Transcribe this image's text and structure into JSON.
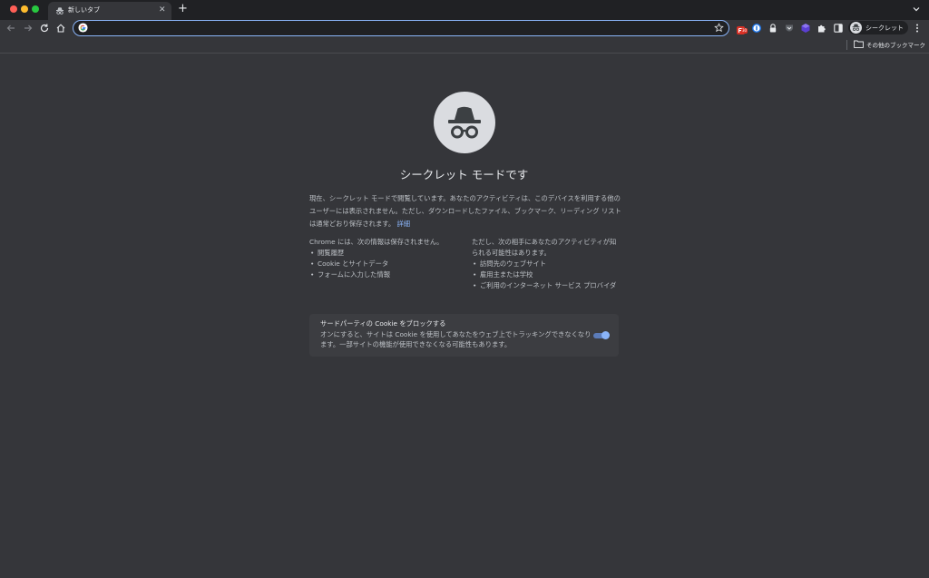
{
  "tab": {
    "title": "新しいタブ",
    "icon": "incognito-icon"
  },
  "omnibox": {
    "value": "",
    "placeholder": ""
  },
  "extensions": {
    "badge_count": "30"
  },
  "profile": {
    "label": "シークレット"
  },
  "bookmarks": {
    "other_label": "その他のブックマーク"
  },
  "incognito": {
    "heading": "シークレット モードです",
    "intro": "現在、シークレット モードで閲覧しています。あなたのアクティビティは、このデバイスを利用する他のユーザーには表示されません。ただし、ダウンロードしたファイル、ブックマーク、リーディング リストは通常どおり保存されます。",
    "learn_more": "詳細",
    "not_saved_title": "Chrome には、次の情報は保存されません。",
    "not_saved_items": [
      "閲覧履歴",
      "Cookie とサイトデータ",
      "フォームに入力した情報"
    ],
    "visible_title": "ただし、次の相手にあなたのアクティビティが知られる可能性はあります。",
    "visible_items": [
      "訪問先のウェブサイト",
      "雇用主または学校",
      "ご利用のインターネット サービス プロバイダ"
    ],
    "cookie_title": "サードパーティの Cookie をブロックする",
    "cookie_desc": "オンにすると、サイトは Cookie を使用してあなたをウェブ上でトラッキングできなくなります。一部サイトの機能が使用できなくなる可能性もあります。",
    "cookie_toggle_on": true
  },
  "colors": {
    "background": "#35363a",
    "tabstrip": "#202124",
    "accent": "#8ab4f8",
    "card": "#3c3d41"
  }
}
